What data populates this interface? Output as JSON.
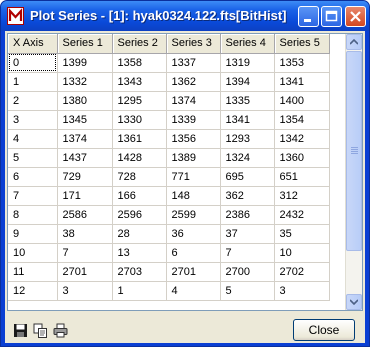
{
  "window": {
    "title": "Plot Series - [1]: hyak0324.122.fts[BitHist]"
  },
  "table": {
    "columns": [
      "X Axis",
      "Series 1",
      "Series 2",
      "Series 3",
      "Series 4",
      "Series 5"
    ],
    "rows": [
      [
        "0",
        "1399",
        "1358",
        "1337",
        "1319",
        "1353"
      ],
      [
        "1",
        "1332",
        "1343",
        "1362",
        "1394",
        "1341"
      ],
      [
        "2",
        "1380",
        "1295",
        "1374",
        "1335",
        "1400"
      ],
      [
        "3",
        "1345",
        "1330",
        "1339",
        "1341",
        "1354"
      ],
      [
        "4",
        "1374",
        "1361",
        "1356",
        "1293",
        "1342"
      ],
      [
        "5",
        "1437",
        "1428",
        "1389",
        "1324",
        "1360"
      ],
      [
        "6",
        "729",
        "728",
        "771",
        "695",
        "651"
      ],
      [
        "7",
        "171",
        "166",
        "148",
        "362",
        "312"
      ],
      [
        "8",
        "2586",
        "2596",
        "2599",
        "2386",
        "2432"
      ],
      [
        "9",
        "38",
        "28",
        "36",
        "37",
        "35"
      ],
      [
        "10",
        "7",
        "13",
        "6",
        "7",
        "10"
      ],
      [
        "11",
        "2701",
        "2703",
        "2701",
        "2700",
        "2702"
      ],
      [
        "12",
        "3",
        "1",
        "4",
        "5",
        "3"
      ]
    ]
  },
  "footer": {
    "close_label": "Close",
    "icons": [
      "save-icon",
      "copy-icon",
      "print-icon"
    ]
  },
  "colors": {
    "titlebar": "#0a4ad9",
    "close_title_button": "#d3471f",
    "dialog_face": "#ece9d8"
  }
}
